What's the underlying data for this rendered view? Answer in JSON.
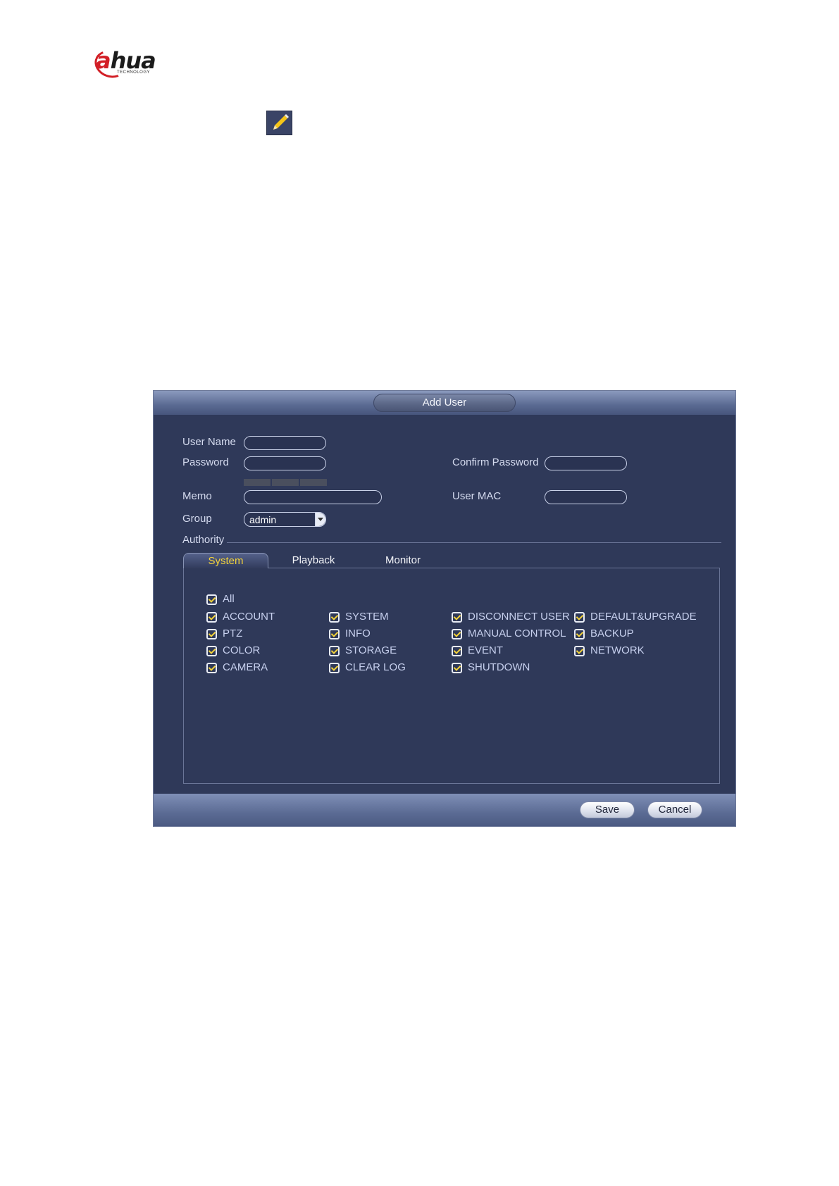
{
  "logo": {
    "brand_a": "a",
    "brand_rest": "hua",
    "subtitle": "TECHNOLOGY"
  },
  "colors": {
    "panel_bg": "#2f3959",
    "active_tab": "#f3d23a",
    "check": "#f3d23a",
    "label": "#c7d0ee"
  },
  "edit_icon": "pencil-icon",
  "dialog": {
    "title": "Add User",
    "labels": {
      "user_name": "User Name",
      "password": "Password",
      "confirm_password": "Confirm Password",
      "memo": "Memo",
      "user_mac": "User MAC",
      "group": "Group",
      "authority": "Authority"
    },
    "values": {
      "user_name": "",
      "password": "",
      "confirm_password": "",
      "memo": "",
      "user_mac": ""
    },
    "group_selected": "admin",
    "tabs": {
      "system": "System",
      "playback": "Playback",
      "monitor": "Monitor"
    },
    "active_tab": "System",
    "permissions": {
      "all": "All",
      "col1": [
        "ACCOUNT",
        "PTZ",
        "COLOR",
        "CAMERA"
      ],
      "col2": [
        "SYSTEM",
        "INFO",
        "STORAGE",
        "CLEAR LOG"
      ],
      "col3": [
        "DISCONNECT USER",
        "MANUAL CONTROL",
        "EVENT",
        "SHUTDOWN"
      ],
      "col4": [
        "DEFAULT&UPGRADE",
        "BACKUP",
        "NETWORK"
      ]
    },
    "buttons": {
      "save": "Save",
      "cancel": "Cancel"
    }
  }
}
